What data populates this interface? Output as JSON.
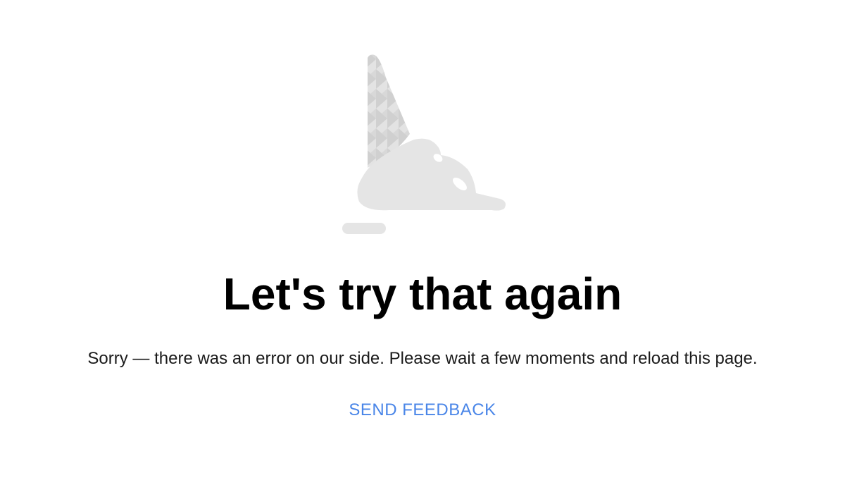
{
  "error": {
    "illustration_icon": "dropped-ice-cream-icon",
    "title": "Let's try that again",
    "message": "Sorry — there was an error on our side. Please wait a few moments and reload this page.",
    "feedback_label": "SEND FEEDBACK"
  },
  "colors": {
    "accent": "#4a86e8",
    "illustration": "#e5e5e5",
    "cone_dark": "#cfcfcf",
    "cone_light": "#e2e2e2"
  }
}
